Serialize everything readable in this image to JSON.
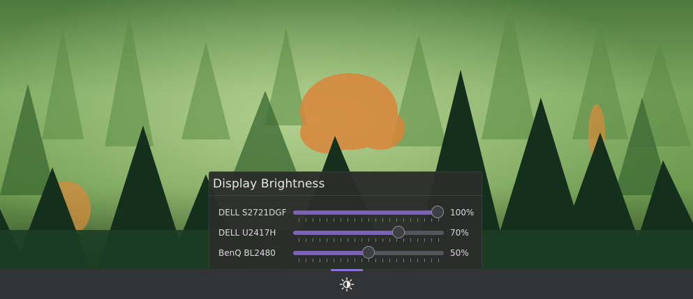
{
  "popup": {
    "title": "Display Brightness",
    "monitors": [
      {
        "name": "DELL S2721DGF",
        "brightness": 100,
        "value_label": "100%"
      },
      {
        "name": "DELL U2417H",
        "brightness": 70,
        "value_label": "70%"
      },
      {
        "name": "BenQ BL2480",
        "brightness": 50,
        "value_label": "50%"
      }
    ]
  },
  "taskbar": {
    "tray_icon": "brightness-icon",
    "active": true
  },
  "colors": {
    "accent": "#7b63b8",
    "popup_bg": "#2b2d2b",
    "taskbar_bg": "#323335"
  }
}
